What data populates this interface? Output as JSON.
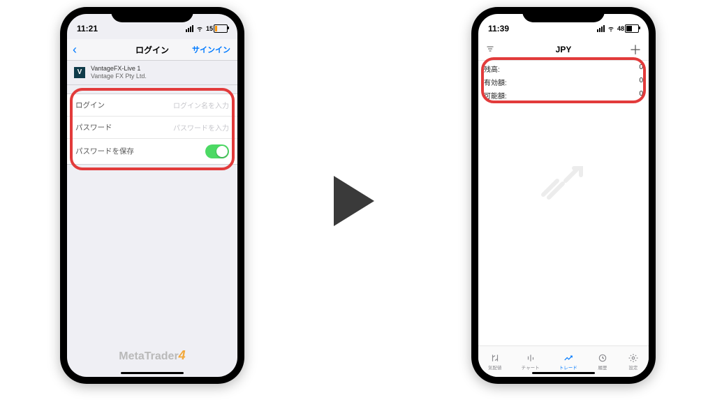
{
  "left": {
    "status": {
      "time": "11:21",
      "battery_pct": 15,
      "battery_fill_css": "width:3px"
    },
    "nav": {
      "title": "ログイン",
      "back_glyph": "‹",
      "action": "サインイン"
    },
    "server": {
      "logo_letter": "V",
      "name": "VantageFX-Live 1",
      "company": "Vantage FX Pty Ltd."
    },
    "form": {
      "login_label": "ログイン",
      "login_placeholder": "ログイン名を入力",
      "password_label": "パスワード",
      "password_placeholder": "パスワードを入力",
      "save_label": "パスワードを保存",
      "save_on": true
    },
    "brand": {
      "text": "MetaTrader",
      "four": "4"
    }
  },
  "right": {
    "status": {
      "time": "11:39",
      "battery_pct": 48,
      "battery_fill_css": "width:8px"
    },
    "nav": {
      "title": "JPY"
    },
    "balance": [
      {
        "label": "残高:",
        "value": "0"
      },
      {
        "label": "有効額:",
        "value": "0"
      },
      {
        "label": "可能額:",
        "value": "0"
      }
    ],
    "tabs": [
      {
        "label": "気配値"
      },
      {
        "label": "チャート"
      },
      {
        "label": "トレード",
        "active": true
      },
      {
        "label": "履歴"
      },
      {
        "label": "設定"
      }
    ]
  },
  "colors": {
    "highlight": "#e23b3b",
    "accent": "#007aff",
    "toggle": "#4cd964"
  }
}
